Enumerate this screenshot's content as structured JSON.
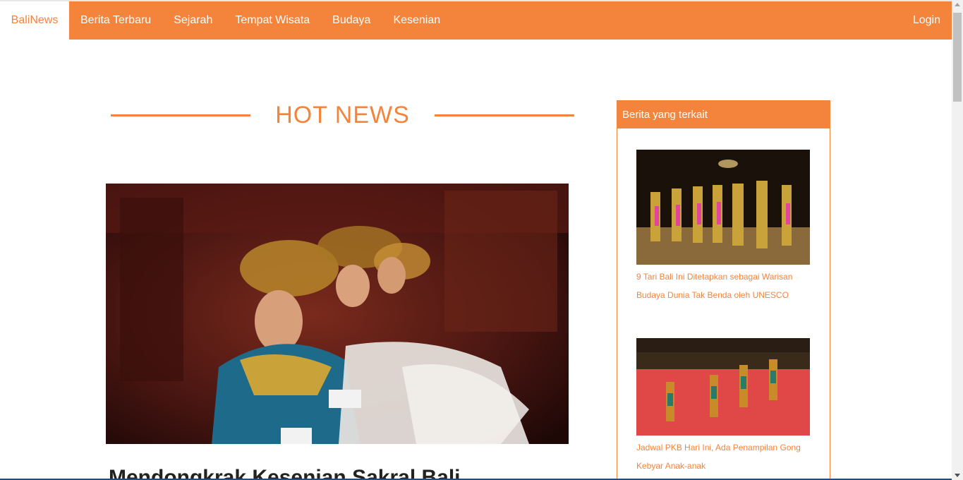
{
  "navbar": {
    "brand": "BaliNews",
    "items": [
      {
        "label": "Berita Terbaru"
      },
      {
        "label": "Sejarah"
      },
      {
        "label": "Tempat Wisata"
      },
      {
        "label": "Budaya"
      },
      {
        "label": "Kesenian"
      }
    ],
    "login": "Login"
  },
  "main": {
    "section_title": "HOT NEWS",
    "article_title": "Mendongkrak Kesenian Sakral Bali"
  },
  "sidebar": {
    "header": "Berita yang terkait",
    "articles": [
      {
        "title": "9 Tari Bali Ini Ditetapkan sebagai Warisan Budaya Dunia Tak Benda oleh UNESCO"
      },
      {
        "title": "Jadwal PKB Hari Ini, Ada Penampilan Gong Kebyar Anak-anak"
      }
    ]
  },
  "colors": {
    "accent": "#f4843c",
    "text_dark": "#222222"
  }
}
